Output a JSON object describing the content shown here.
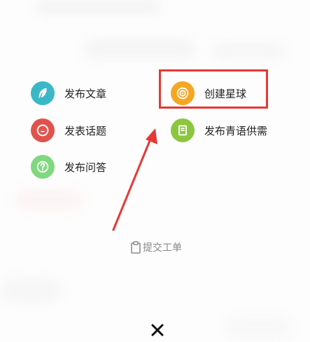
{
  "menu": {
    "publish_article": "发布文章",
    "publish_topic": "发表话题",
    "publish_question": "发布问答",
    "create_planet": "创建星球",
    "publish_request": "发布青语供需"
  },
  "footer": {
    "ticket_label": "提交工单"
  },
  "colors": {
    "article": "#3bb8c8",
    "topic": "#e0534d",
    "question": "#7fd87f",
    "planet": "#f5a623",
    "request": "#8cc63f",
    "highlight": "#e53935"
  },
  "icons": {
    "article": "feather-icon",
    "topic": "speech-bubble-icon",
    "question": "question-mark-icon",
    "planet": "planet-icon",
    "request": "bookmark-doc-icon",
    "ticket": "clipboard-icon",
    "close": "close-icon"
  }
}
